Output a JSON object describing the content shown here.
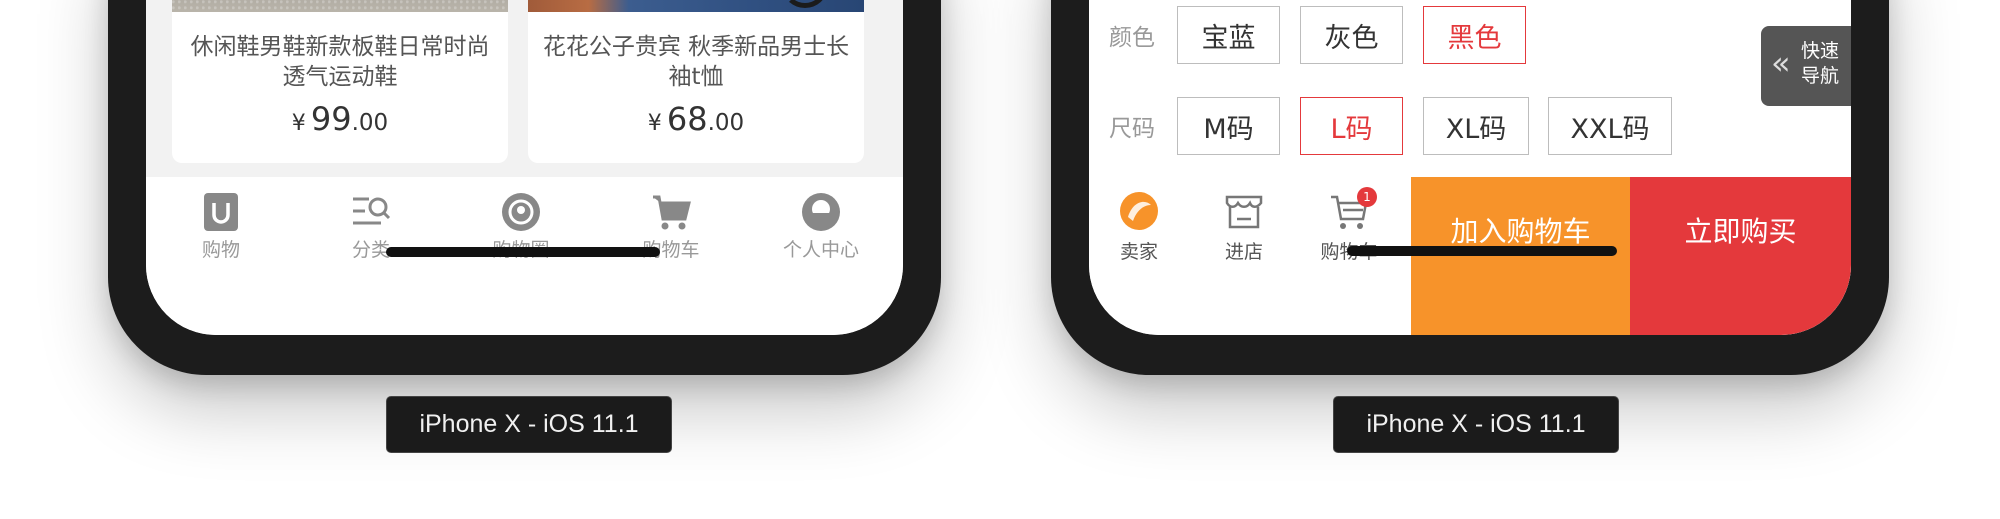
{
  "left_phone": {
    "products": [
      {
        "title": "休闲鞋男鞋新款板鞋日常时尚透气运动鞋",
        "currency": "¥",
        "price_int": "99",
        "price_dec": ".00"
      },
      {
        "title": "花花公子贵宾 秋季新品男士长袖t恤",
        "currency": "¥",
        "price_int": "68",
        "price_dec": ".00"
      }
    ],
    "tabbar": [
      {
        "label": "购物",
        "icon": "shop-u-icon"
      },
      {
        "label": "分类",
        "icon": "category-search-icon"
      },
      {
        "label": "购物圈",
        "icon": "shopping-circle-icon"
      },
      {
        "label": "购物车",
        "icon": "cart-icon"
      },
      {
        "label": "个人中心",
        "icon": "profile-icon"
      }
    ],
    "caption": "iPhone X - iOS 11.1"
  },
  "right_phone": {
    "color_label": "颜色",
    "colors": [
      {
        "label": "宝蓝",
        "selected": false
      },
      {
        "label": "灰色",
        "selected": false
      },
      {
        "label": "黑色",
        "selected": true
      }
    ],
    "size_label": "尺码",
    "sizes": [
      {
        "label": "M码",
        "selected": false
      },
      {
        "label": "L码",
        "selected": true
      },
      {
        "label": "XL码",
        "selected": false
      },
      {
        "label": "XXL码",
        "selected": false
      }
    ],
    "quick_nav": {
      "line1": "快速",
      "line2": "导航",
      "icon": "double-chevron-left-icon"
    },
    "actions": [
      {
        "label": "卖家",
        "icon": "seller-icon"
      },
      {
        "label": "进店",
        "icon": "store-icon"
      },
      {
        "label": "购物车",
        "icon": "cart-icon",
        "badge": "1"
      }
    ],
    "add_to_cart": "加入购物车",
    "buy_now": "立即购买",
    "caption": "iPhone X - iOS 11.1"
  },
  "colors": {
    "accent_red": "#e4393c",
    "accent_orange": "#f7932a",
    "frame": "#1c1c1c"
  }
}
